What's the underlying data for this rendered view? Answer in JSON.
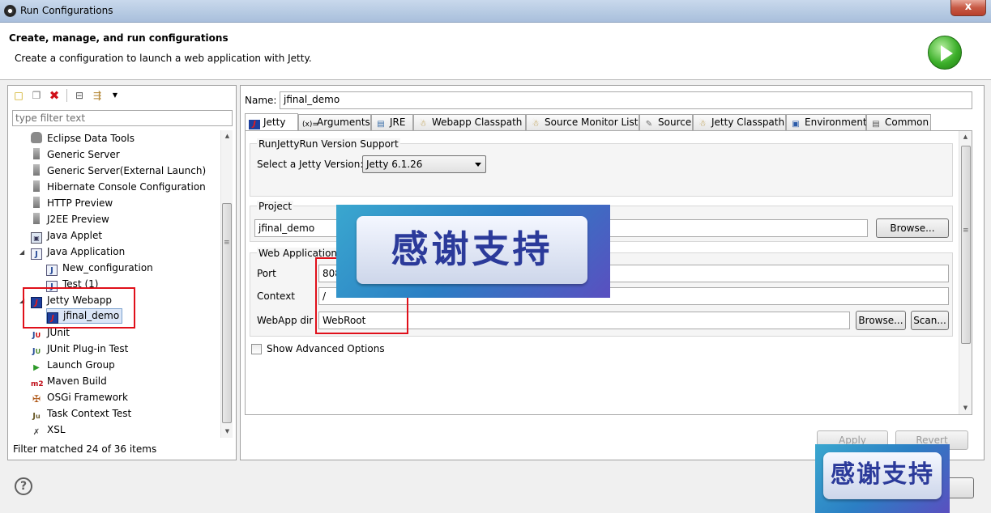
{
  "window": {
    "title": "Run Configurations",
    "close": "x"
  },
  "header": {
    "title": "Create, manage, and run configurations",
    "subtitle": "Create a configuration to launch a web application with Jetty."
  },
  "left": {
    "filter_placeholder": "type filter text",
    "tree": [
      {
        "label": "Eclipse Data Tools",
        "icon": "database-icon"
      },
      {
        "label": "Generic Server",
        "icon": "server-icon"
      },
      {
        "label": "Generic Server(External Launch)",
        "icon": "server-icon"
      },
      {
        "label": "Hibernate Console Configuration",
        "icon": "server-icon"
      },
      {
        "label": "HTTP Preview",
        "icon": "server-icon"
      },
      {
        "label": "J2EE Preview",
        "icon": "server-icon"
      },
      {
        "label": "Java Applet",
        "icon": "applet-icon"
      },
      {
        "label": "Java Application",
        "icon": "java-app-icon"
      },
      {
        "label": "New_configuration",
        "icon": "java-file-icon"
      },
      {
        "label": "Test (1)",
        "icon": "java-file-icon"
      },
      {
        "label": "Jetty Webapp",
        "icon": "jetty-icon"
      },
      {
        "label": "jfinal_demo",
        "icon": "jetty-icon"
      },
      {
        "label": "JUnit",
        "icon": "junit-icon"
      },
      {
        "label": "JUnit Plug-in Test",
        "icon": "junit-plugin-icon"
      },
      {
        "label": "Launch Group",
        "icon": "launch-group-icon"
      },
      {
        "label": "Maven Build",
        "icon": "maven-icon"
      },
      {
        "label": "OSGi Framework",
        "icon": "osgi-icon"
      },
      {
        "label": "Task Context Test",
        "icon": "task-context-icon"
      },
      {
        "label": "XSL",
        "icon": "xsl-icon"
      }
    ],
    "status": "Filter matched 24 of 36 items"
  },
  "right": {
    "name_label": "Name:",
    "name_value": "jfinal_demo",
    "tabs": [
      "Jetty",
      "Arguments",
      "JRE",
      "Webapp Classpath",
      "Source Monitor List",
      "Source",
      "Jetty Classpath",
      "Environment",
      "Common"
    ],
    "support_group": {
      "title": "RunJettyRun Version Support",
      "select_label": "Select a Jetty Version:",
      "select_value": "Jetty 6.1.26"
    },
    "project_group": {
      "title": "Project",
      "project_value": "jfinal_demo",
      "browse": "Browse..."
    },
    "webapp_group": {
      "title": "Web Application",
      "port_label": "Port",
      "port_value": "808",
      "context_label": "Context",
      "context_value": "/",
      "webapp_dir_label": "WebApp dir",
      "webapp_dir_value": "WebRoot",
      "browse": "Browse...",
      "scan": "Scan..."
    },
    "advanced_label": "Show Advanced Options",
    "apply": "Apply",
    "revert": "Revert"
  },
  "watermark": {
    "text": "感谢支持"
  },
  "help": "?"
}
